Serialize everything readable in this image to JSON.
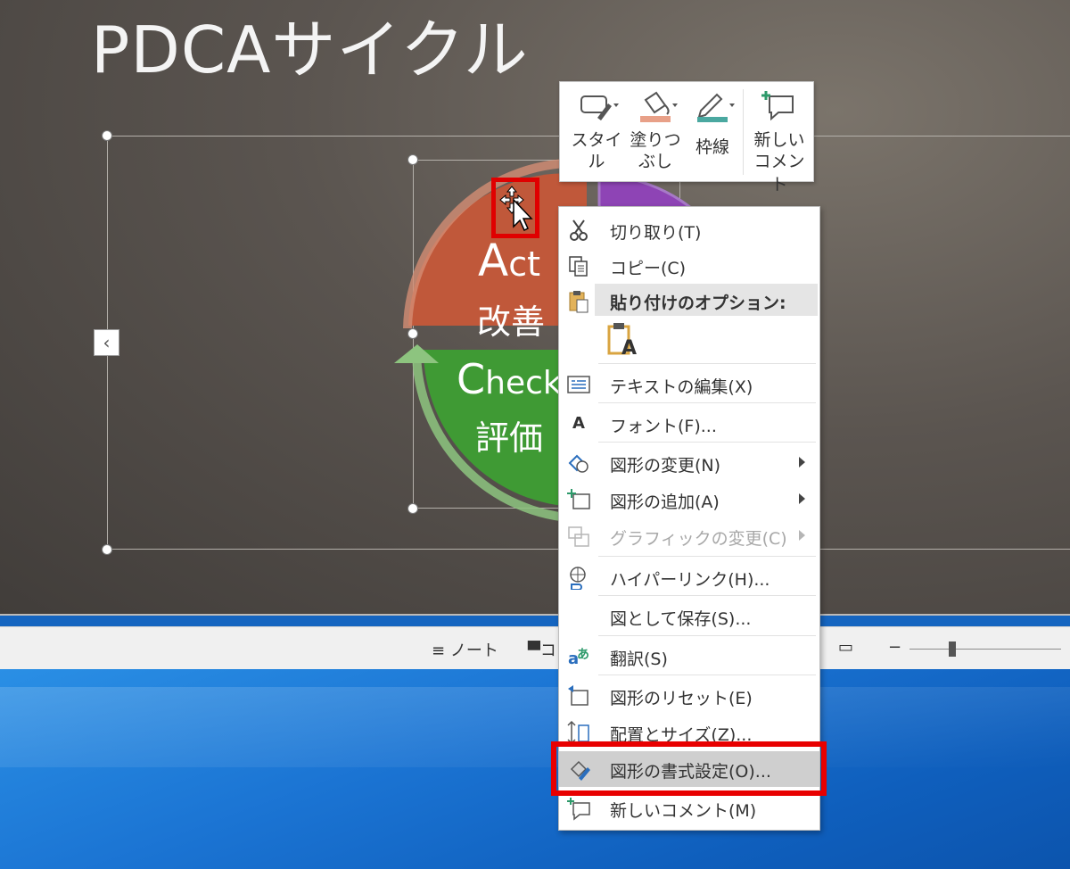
{
  "slide": {
    "title": "PDCAサイクル",
    "segments": {
      "act_letter": "A",
      "act_rest": "ct",
      "act_jp": "改善",
      "check_letter": "C",
      "check_rest": "heck",
      "check_jp": "評価"
    }
  },
  "mini_toolbar": {
    "style_label_1": "スタイ",
    "style_label_2": "ル",
    "fill_label_1": "塗りつ",
    "fill_label_2": "ぶし",
    "outline_label": "枠線",
    "comment_label_1": "新しい",
    "comment_label_2": "コメント"
  },
  "context_menu": {
    "cut": "切り取り(T)",
    "copy": "コピー(C)",
    "paste_options_header": "貼り付けのオプション:",
    "paste_option_icon_letter": "A",
    "edit_text": "テキストの編集(X)",
    "font": "フォント(F)...",
    "change_shape": "図形の変更(N)",
    "add_shape": "図形の追加(A)",
    "change_graphic": "グラフィックの変更(C)",
    "hyperlink": "ハイパーリンク(H)...",
    "save_as_picture": "図として保存(S)...",
    "translate": "翻訳(S)",
    "reset_shape": "図形のリセット(E)",
    "size_position": "配置とサイズ(Z)...",
    "format_shape": "図形の書式設定(O)...",
    "new_comment": "新しいコメント(M)"
  },
  "status_bar": {
    "notes": "ノート",
    "comments_partial": "コ",
    "zoom_minus": "−"
  },
  "colors": {
    "act": "#c0583a",
    "do": "#8e44b5",
    "check": "#3f9a34",
    "highlight": "#e00000",
    "menu_hover": "#cfcfcf"
  }
}
